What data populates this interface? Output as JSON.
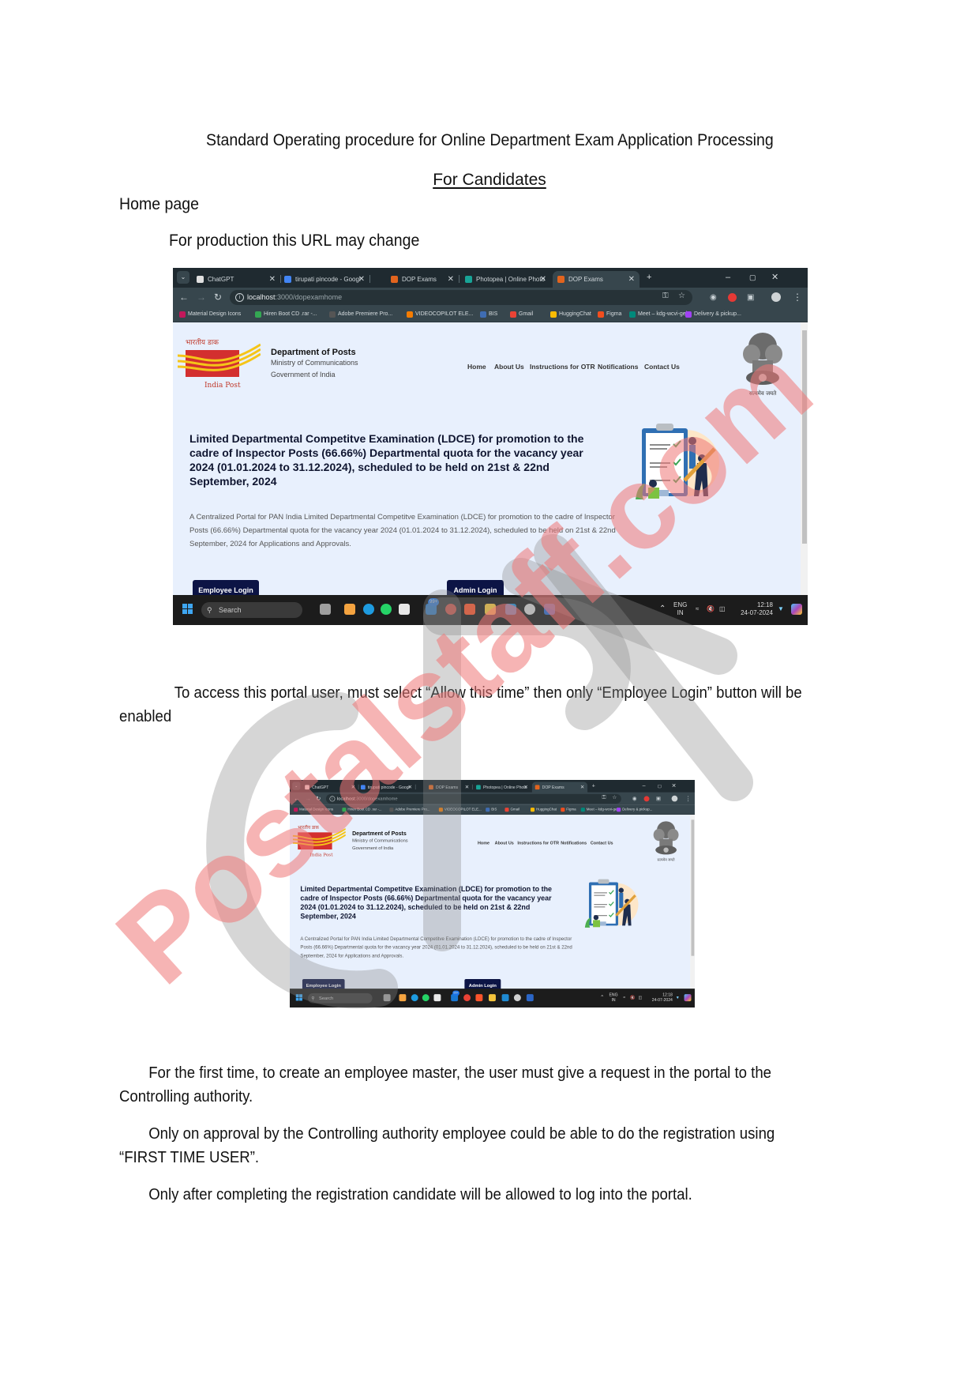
{
  "document": {
    "title": "Standard Operating procedure for Online Department Exam Application Processing",
    "subtitle": "For Candidates",
    "section_heading": "Home page",
    "url_note": "For production this URL may change",
    "paragraph_access": "To access this portal user, must select “Allow this time” then only “Employee Login” button will be enabled",
    "paragraph_first_time": "For the first time, to create an employee master, the user must give a request in the portal to the Controlling authority.",
    "paragraph_approval": "Only on approval by the Controlling authority employee could be able to do the registration using “FIRST TIME USER”.",
    "paragraph_login": "Only after completing the registration candidate will be allowed to log into the portal.",
    "watermark": "Postalstaff.com"
  },
  "browser": {
    "tabs": [
      {
        "label": "ChatGPT",
        "icon": "chatgpt-icon",
        "color": "#e0e0e0"
      },
      {
        "label": "tirupati pincode - Googl",
        "icon": "google-icon",
        "color": "#4285f4"
      },
      {
        "label": "DOP Exams",
        "icon": "dop-icon",
        "color": "#e2641e"
      },
      {
        "label": "Photopea | Online Photo",
        "icon": "photopea-icon",
        "color": "#18a497"
      },
      {
        "label": "DOP Exams",
        "icon": "dop-icon",
        "color": "#e2641e",
        "active": true
      }
    ],
    "new_tab": "+",
    "window_controls": {
      "minimize": "–",
      "restore": "▢",
      "close": "✕"
    },
    "url_host": "localhost",
    "url_path": ":3000/dopexamhome",
    "bookmarks": [
      {
        "label": "Material Design Icons",
        "color": "#c2185b"
      },
      {
        "label": "Hiren Boot CD .rar -...",
        "color": "#34a853"
      },
      {
        "label": "Adobe Premiere Pro...",
        "color": "#555555"
      },
      {
        "label": "VIDEOCOPILOT ELE...",
        "color": "#f57c00"
      },
      {
        "label": "BIS",
        "color": "#3f6db3"
      },
      {
        "label": "Gmail",
        "color": "#ea4335"
      },
      {
        "label": "HuggingChat",
        "color": "#fbbc04"
      },
      {
        "label": "Figma",
        "color": "#f24e1e"
      },
      {
        "label": "Meet – kdg-wcvi-gel",
        "color": "#00897b"
      },
      {
        "label": "Delivery & pickup...",
        "color": "#a142f4"
      }
    ]
  },
  "site": {
    "org_name": "Department of Posts",
    "ministry": "Ministry of Communications",
    "government": "Government of India",
    "logo_text_hindi": "भारतीय डाक",
    "logo_text_en": "India Post",
    "emblem_caption": "सत्यमेव जयते",
    "nav": [
      "Home",
      "About Us",
      "Instructions for OTR",
      "Notifications",
      "Contact Us"
    ],
    "hero_title": "Limited Departmental Competitve Examination (LDCE) for promotion to the cadre of Inspector Posts (66.66%) Departmental quota for the vacancy year 2024 (01.01.2024 to 31.12.2024), scheduled to be held on 21st & 22nd September, 2024",
    "hero_description": "A Centralized Portal for PAN India Limited Departmental Competitve Examination (LDCE) for promotion to the cadre of Inspector Posts (66.66%) Departmental quota for the vacancy year 2024 (01.01.2024 to 31.12.2024), scheduled to be held on 21st & 22nd September, 2024 for Applications and Approvals.",
    "employee_login": "Employee Login",
    "admin_login": "Admin Login",
    "brand_color": "#0c1445"
  },
  "taskbar": {
    "search_placeholder": "Search",
    "language": "ENG",
    "region": "IN",
    "time": "12:18",
    "date": "24-07-2024",
    "badge_count": "99+"
  }
}
